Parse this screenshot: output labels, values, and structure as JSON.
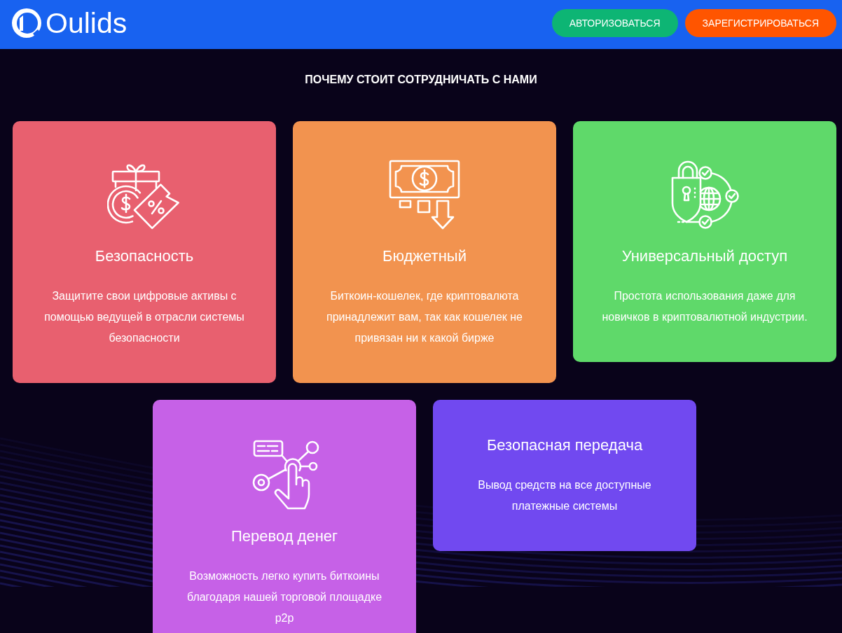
{
  "header": {
    "logo": {
      "text": "Oulids"
    },
    "buttons": [
      {
        "label": "АВТОРИЗОВАТЬСЯ",
        "color": "#0db574"
      },
      {
        "label": "ЗАРЕГИСТРИРОВАТЬСЯ",
        "color": "#ff5500"
      }
    ]
  },
  "section": {
    "title": "ПОЧЕМУ СТОИТ СОТРУДНИЧАТЬ С НАМИ",
    "cards": [
      {
        "title": "Безопасность",
        "text": "Защитите свои цифровые активы с помощью ведущей в отрасли системы безопасности",
        "color": "#e8606f"
      },
      {
        "title": "Бюджетный",
        "text": "Биткоин-кошелек, где криптовалюта принадлежит вам, так как кошелек не привязан ни к какой бирже",
        "color": "#f2934f"
      },
      {
        "title": "Универсальный доступ",
        "text": "Простота использования даже для новичков в криптовалютной индустрии.",
        "color": "#5fd96a"
      },
      {
        "title": "Перевод денег",
        "text": "Возможность легко купить биткоины благодаря нашей торговой площадке p2p",
        "color": "#c661e7"
      },
      {
        "title": "Безопасная передача",
        "text": "Вывод средств на все доступные платежные системы",
        "color": "#7149f0"
      }
    ]
  }
}
